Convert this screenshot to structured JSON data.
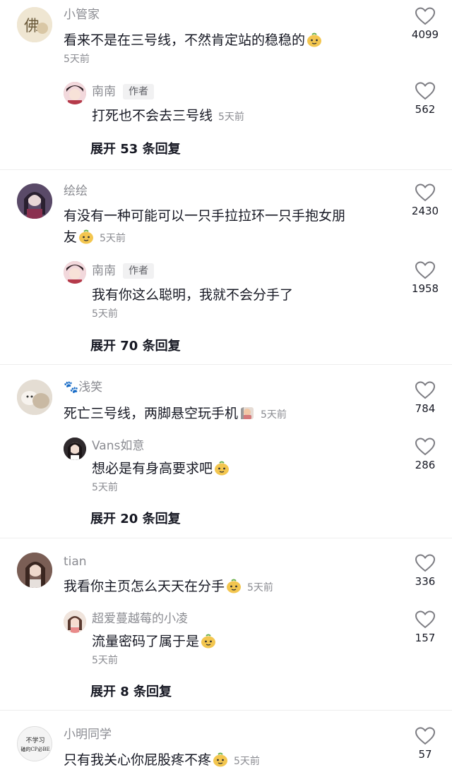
{
  "threads": [
    {
      "comment": {
        "user": "小管家",
        "text": "看来不是在三号线，不然肯定站的稳稳的",
        "emoji": "smirk-emoji",
        "time": "5天前",
        "likes": "4099",
        "avatar_color": "#e9dfc9"
      },
      "reply": {
        "user": "南南",
        "author_tag": "作者",
        "text": "打死也不会去三号线",
        "time": "5天前",
        "likes": "562",
        "avatar_color": "#c7a0a8"
      },
      "expand": "展开 53 条回复"
    },
    {
      "comment": {
        "user": "绘绘",
        "text_line1": "有没有一种可能可以一只手拉拉环一只手抱女朋",
        "text_line2": "友",
        "emoji": "smirk-emoji",
        "time": "5天前",
        "likes": "2430",
        "avatar_color": "#6b5a78"
      },
      "reply": {
        "user": "南南",
        "author_tag": "作者",
        "text": "我有你这么聪明，我就不会分手了",
        "time": "5天前",
        "likes": "1958",
        "avatar_color": "#c7a0a8"
      },
      "expand": "展开 70 条回复"
    },
    {
      "comment": {
        "user": "🐾浅笑",
        "text": "死亡三号线，两脚悬空玩手机",
        "emoji": "bow-emoji",
        "time": "5天前",
        "likes": "784",
        "avatar_color": "#d8cfc4"
      },
      "reply": {
        "user": "Vans如意",
        "text": "想必是有身高要求吧",
        "emoji": "smirk-emoji",
        "time": "5天前",
        "likes": "286",
        "avatar_color": "#3c3439"
      },
      "expand": "展开 20 条回复"
    },
    {
      "comment": {
        "user": "tian",
        "text": "我看你主页怎么天天在分手",
        "emoji": "smirk-emoji",
        "time": "5天前",
        "likes": "336",
        "avatar_color": "#8a6a60"
      },
      "reply": {
        "user": "超爱蔓越莓的小凌",
        "text": "流量密码了属于是",
        "emoji": "smirk-emoji",
        "time": "5天前",
        "likes": "157",
        "avatar_color": "#d9b8a8"
      },
      "expand": "展开 8 条回复"
    },
    {
      "comment": {
        "user": "小明同学",
        "text": "只有我关心你屁股疼不疼",
        "emoji": "smirk-emoji",
        "time": "5天前",
        "likes": "57",
        "avatar_color": "#eeeeee",
        "avatar_text_1": "不学习",
        "avatar_text_2": "磕的CP必BE"
      }
    }
  ],
  "colors": {
    "text": "#161823",
    "muted": "#8a8b91",
    "divider": "#eeeeee"
  }
}
